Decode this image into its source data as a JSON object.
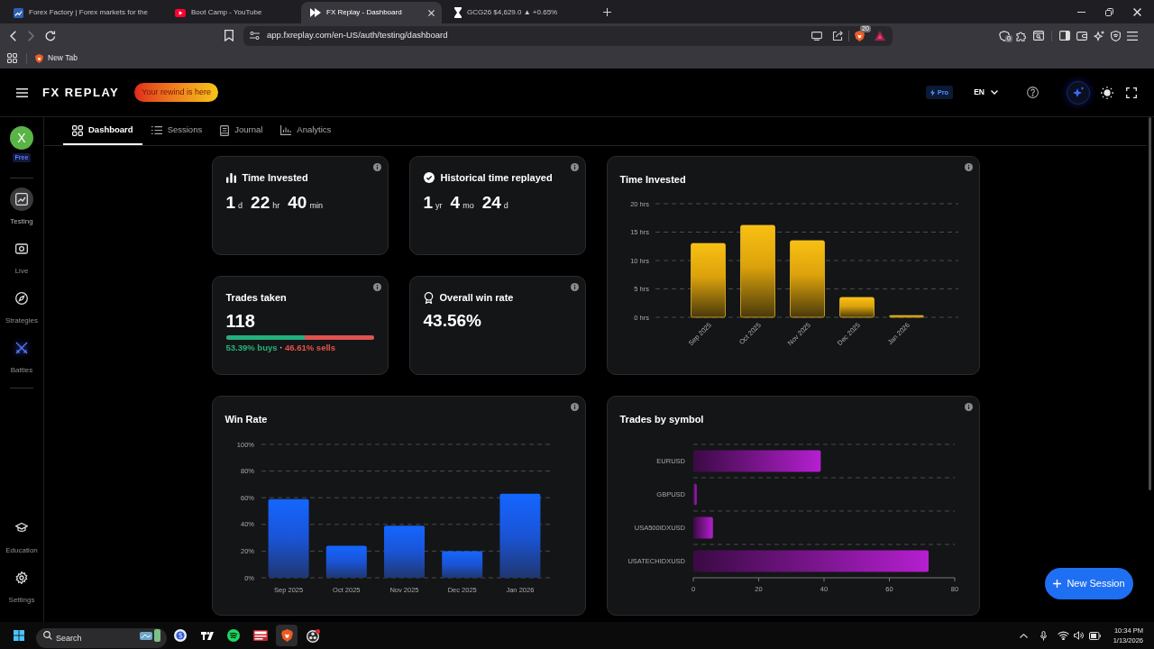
{
  "browser": {
    "tabs": [
      {
        "title": "Forex Factory | Forex markets for the",
        "selected": false
      },
      {
        "title": "Boot Camp - YouTube",
        "selected": false
      },
      {
        "title": "FX Replay - Dashboard",
        "selected": true
      },
      {
        "title": "GCG26 $4,629.0 ▲ +0.65%",
        "selected": false
      }
    ],
    "address": "app.fxreplay.com/en-US/auth/testing/dashboard",
    "shields_count": "20",
    "extension_count": "0",
    "bookmarks": [
      "New Tab"
    ]
  },
  "header": {
    "logo": "FX REPLAY",
    "promo": "Your rewind is here",
    "plan_badge": "Pro",
    "language": "EN"
  },
  "sidebar": {
    "avatar": "X",
    "plan": "Free",
    "items": [
      {
        "label": "Testing",
        "selected": true
      },
      {
        "label": "Live",
        "selected": false
      },
      {
        "label": "Strategies",
        "selected": false
      },
      {
        "label": "Battles",
        "selected": false
      }
    ],
    "bottom_items": [
      {
        "label": "Education",
        "selected": false
      },
      {
        "label": "Settings",
        "selected": false
      }
    ]
  },
  "nav_tabs": [
    {
      "label": "Dashboard",
      "selected": true
    },
    {
      "label": "Sessions",
      "selected": false
    },
    {
      "label": "Journal",
      "selected": false
    },
    {
      "label": "Analytics",
      "selected": false
    }
  ],
  "stat_cards": [
    {
      "kind": "duration",
      "title": "Time Invested",
      "parts": [
        {
          "value": "1",
          "unit": "d"
        },
        {
          "value": "22",
          "unit": "hr"
        },
        {
          "value": "40",
          "unit": "min"
        }
      ]
    },
    {
      "kind": "duration",
      "title": "Historical time replayed",
      "parts": [
        {
          "value": "1",
          "unit": "yr"
        },
        {
          "value": "4",
          "unit": "mo"
        },
        {
          "value": "24",
          "unit": "d"
        }
      ]
    },
    {
      "kind": "split",
      "title": "Trades taken",
      "value": "118",
      "level": 0.5339,
      "buys": "53.39% buys",
      "separator": "·",
      "sells": "46.61% sells"
    },
    {
      "kind": "single",
      "title": "Overall win rate",
      "value": "43.56%"
    }
  ],
  "charts": [
    {
      "chart_data": {
        "type": "bar",
        "title": "Time Invested",
        "categories": [
          "Sep 2025",
          "Oct 2025",
          "Nov 2025",
          "Dec 2025",
          "Jan 2026"
        ],
        "values": [
          13,
          16.2,
          13.5,
          3.5,
          0.3
        ],
        "ylim": [
          0,
          20
        ],
        "yticks": [
          {
            "value": 0,
            "label": "0 hrs"
          },
          {
            "value": 5,
            "label": "5 hrs"
          },
          {
            "value": 10,
            "label": "10 hrs"
          },
          {
            "value": 15,
            "label": "15 hrs"
          },
          {
            "value": 20,
            "label": "20 hrs"
          }
        ],
        "grid": true
      }
    },
    {
      "chart_data": {
        "type": "bar",
        "title": "Win Rate",
        "categories": [
          "Sep 2025",
          "Oct 2025",
          "Nov 2025",
          "Dec 2025",
          "Jan 2026"
        ],
        "values": [
          59,
          24,
          39,
          20,
          63
        ],
        "ylim": [
          0,
          100
        ],
        "yticks": [
          {
            "value": 0,
            "label": "0%"
          },
          {
            "value": 20,
            "label": "20%"
          },
          {
            "value": 40,
            "label": "40%"
          },
          {
            "value": 60,
            "label": "60%"
          },
          {
            "value": 80,
            "label": "80%"
          },
          {
            "value": 100,
            "label": "100%"
          }
        ],
        "grid": true
      }
    },
    {
      "chart_data": {
        "type": "bar",
        "orientation": "horizontal",
        "title": "Trades by symbol",
        "categories": [
          "EURUSD",
          "GBPUSD",
          "USA500IDXUSD",
          "USATECHIDXUSD"
        ],
        "values": [
          39,
          1,
          6,
          72
        ],
        "xlim": [
          0,
          80
        ],
        "xticks": [
          0,
          20,
          40,
          60,
          80
        ],
        "grid": true
      }
    }
  ],
  "new_session_button": "New Session",
  "taskbar": {
    "search": {
      "placeholder": "Search"
    },
    "apps": [
      {
        "selected": false
      },
      {
        "selected": false
      },
      {
        "selected": false
      },
      {
        "selected": false
      },
      {
        "selected": true
      },
      {
        "selected": false
      }
    ],
    "time": "10:34 PM",
    "date": "1/13/2026"
  }
}
